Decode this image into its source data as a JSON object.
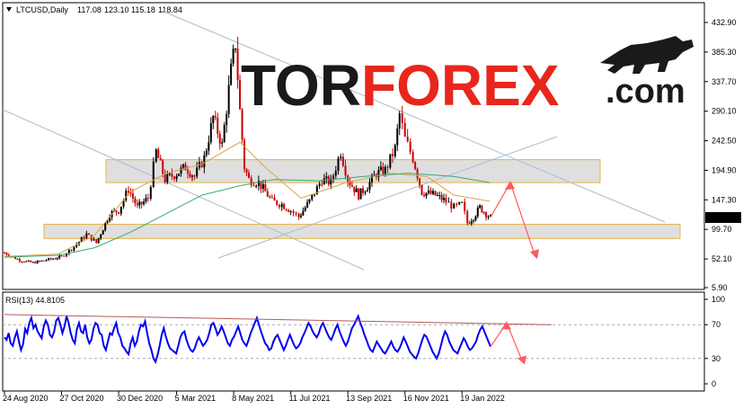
{
  "chart_header": {
    "symbol_label": "LTCUSD,Daily",
    "ohlc": [
      "117.08",
      "123.10",
      "115.18",
      "118.84"
    ]
  },
  "watermark": {
    "part1": "TOR",
    "part2": "FOREX",
    "part3": ".com"
  },
  "colors": {
    "candle_up": "#000000",
    "candle_down": "#cc0000",
    "ma_fast": "#d9a441",
    "ma_slow": "#3aa87a",
    "trend_lines": "#a9bccd",
    "zone_fill": "#d9d9d9",
    "zone_border": "#e6b44a",
    "forecast_arrow": "#ff5a5a",
    "rsi_line": "#0000ee",
    "rsi_trend": "#b35a5a",
    "logo_dark": "#1a1a1a",
    "logo_red": "#e8261c"
  },
  "chart_data": [
    {
      "type": "candlestick",
      "title": "LTCUSD,Daily",
      "x_tick_labels": [
        "24 Aug 2020",
        "27 Oct 2020",
        "30 Dec 2020",
        "5 Mar 2021",
        "8 May 2021",
        "11 Jul 2021",
        "13 Sep 2021",
        "16 Nov 2021",
        "19 Jan 2022"
      ],
      "y_tick_labels": [
        "432.90",
        "385.30",
        "337.70",
        "290.10",
        "242.50",
        "194.90",
        "147.30",
        "99.70",
        "52.10",
        "5.90"
      ],
      "ylim": [
        5.9,
        432.9
      ],
      "current_price_label": "118.84",
      "close_path": [
        [
          "2020-08-24",
          62
        ],
        [
          "2020-09-10",
          50
        ],
        [
          "2020-09-25",
          46
        ],
        [
          "2020-10-15",
          52
        ],
        [
          "2020-10-27",
          56
        ],
        [
          "2020-11-10",
          72
        ],
        [
          "2020-11-24",
          92
        ],
        [
          "2020-12-05",
          78
        ],
        [
          "2020-12-20",
          125
        ],
        [
          "2020-12-30",
          130
        ],
        [
          "2021-01-10",
          165
        ],
        [
          "2021-01-20",
          135
        ],
        [
          "2021-02-01",
          150
        ],
        [
          "2021-02-10",
          225
        ],
        [
          "2021-02-20",
          180
        ],
        [
          "2021-03-05",
          190
        ],
        [
          "2021-03-15",
          200
        ],
        [
          "2021-03-25",
          185
        ],
        [
          "2021-04-05",
          215
        ],
        [
          "2021-04-15",
          280
        ],
        [
          "2021-04-25",
          235
        ],
        [
          "2021-05-05",
          355
        ],
        [
          "2021-05-10",
          400
        ],
        [
          "2021-05-15",
          290
        ],
        [
          "2021-05-20",
          200
        ],
        [
          "2021-05-25",
          180
        ],
        [
          "2021-06-05",
          175
        ],
        [
          "2021-06-20",
          145
        ],
        [
          "2021-07-01",
          140
        ],
        [
          "2021-07-11",
          130
        ],
        [
          "2021-07-20",
          120
        ],
        [
          "2021-08-01",
          145
        ],
        [
          "2021-08-15",
          180
        ],
        [
          "2021-08-25",
          175
        ],
        [
          "2021-09-05",
          225
        ],
        [
          "2021-09-13",
          180
        ],
        [
          "2021-09-25",
          155
        ],
        [
          "2021-10-05",
          170
        ],
        [
          "2021-10-15",
          190
        ],
        [
          "2021-10-25",
          195
        ],
        [
          "2021-11-05",
          230
        ],
        [
          "2021-11-10",
          285
        ],
        [
          "2021-11-16",
          245
        ],
        [
          "2021-11-25",
          215
        ],
        [
          "2021-12-05",
          160
        ],
        [
          "2021-12-20",
          155
        ],
        [
          "2022-01-01",
          145
        ],
        [
          "2022-01-10",
          135
        ],
        [
          "2022-01-19",
          140
        ],
        [
          "2022-01-25",
          110
        ],
        [
          "2022-02-01",
          120
        ],
        [
          "2022-02-08",
          135
        ],
        [
          "2022-02-15",
          125
        ],
        [
          "2022-02-20",
          119
        ]
      ],
      "moving_averages": [
        {
          "name": "MA fast",
          "values": [
            [
              0,
              56
            ],
            [
              60,
              60
            ],
            [
              100,
              90
            ],
            [
              140,
              160
            ],
            [
              180,
              190
            ],
            [
              220,
              205
            ],
            [
              262,
              240
            ],
            [
              290,
              200
            ],
            [
              330,
              150
            ],
            [
              380,
              175
            ],
            [
              430,
              190
            ],
            [
              470,
              185
            ],
            [
              500,
              155
            ],
            [
              540,
              145
            ]
          ]
        },
        {
          "name": "MA slow",
          "values": [
            [
              0,
              55
            ],
            [
              60,
              58
            ],
            [
              100,
              70
            ],
            [
              140,
              95
            ],
            [
              180,
              125
            ],
            [
              220,
              155
            ],
            [
              262,
              170
            ],
            [
              300,
              180
            ],
            [
              350,
              178
            ],
            [
              400,
              185
            ],
            [
              450,
              190
            ],
            [
              500,
              185
            ],
            [
              540,
              175
            ]
          ]
        }
      ],
      "zones": [
        {
          "name": "resistance",
          "from": 175,
          "to": 212
        },
        {
          "name": "support",
          "from": 85,
          "to": 108
        }
      ],
      "forecast": {
        "up_to": 175,
        "down_to": 55
      }
    },
    {
      "type": "line",
      "title": "RSI(13) 44.8105",
      "indicator_label": "RSI(13)",
      "indicator_value": "44.8105",
      "y_tick_labels": [
        "100",
        "70",
        "30",
        "0"
      ],
      "ylim": [
        0,
        100
      ],
      "levels": [
        70,
        30
      ],
      "values": [
        55,
        52,
        60,
        48,
        45,
        55,
        62,
        50,
        40,
        47,
        65,
        60,
        72,
        78,
        66,
        70,
        62,
        58,
        54,
        68,
        75,
        70,
        58,
        55,
        62,
        75,
        78,
        70,
        60,
        68,
        80,
        72,
        60,
        52,
        48,
        65,
        72,
        62,
        60,
        70,
        55,
        48,
        52,
        65,
        72,
        70,
        60,
        58,
        45,
        40,
        50,
        60,
        58,
        66,
        72,
        60,
        55,
        45,
        42,
        38,
        35,
        48,
        55,
        45,
        50,
        62,
        70,
        68,
        74,
        60,
        48,
        40,
        30,
        26,
        34,
        45,
        58,
        66,
        56,
        48,
        42,
        40,
        38,
        36,
        45,
        55,
        60,
        62,
        52,
        45,
        40,
        38,
        42,
        50,
        55,
        50,
        45,
        48,
        52,
        60,
        70,
        72,
        66,
        58,
        62,
        68,
        62,
        55,
        48,
        45,
        52,
        56,
        62,
        68,
        60,
        52,
        48,
        45,
        52,
        60,
        66,
        72,
        78,
        70,
        62,
        55,
        48,
        45,
        40,
        42,
        50,
        55,
        58,
        52,
        46,
        40,
        45,
        52,
        58,
        52,
        46,
        42,
        44,
        48,
        55,
        60,
        66,
        72,
        68,
        62,
        58,
        55,
        60,
        68,
        72,
        66,
        60,
        55,
        52,
        58,
        65,
        70,
        62,
        56,
        50,
        45,
        50,
        58,
        66,
        70,
        75,
        80,
        72,
        66,
        58,
        52,
        45,
        40,
        38,
        44,
        50,
        46,
        42,
        38,
        36,
        40,
        45,
        50,
        44,
        40,
        38,
        42,
        48,
        55,
        50,
        44,
        38,
        35,
        32,
        30,
        36,
        44,
        52,
        58,
        56,
        50,
        44,
        38,
        34,
        30,
        36,
        45,
        55,
        62,
        58,
        50,
        45,
        40,
        38,
        36,
        42,
        48,
        54,
        50,
        44,
        40,
        42,
        46,
        50,
        58,
        64,
        68,
        62,
        56,
        50,
        44
      ],
      "trend_line": {
        "from": 82,
        "to": 70
      },
      "forecast": {
        "up_to": 72,
        "down_to": 25
      }
    }
  ]
}
